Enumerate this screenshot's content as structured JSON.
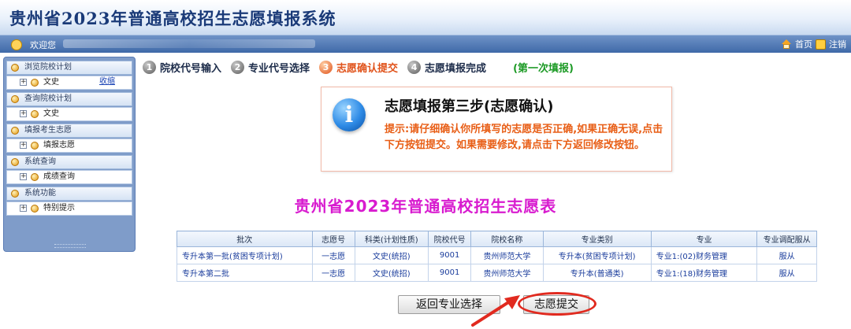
{
  "header": {
    "title": "贵州省2023年普通高校招生志愿填报系统"
  },
  "navbar": {
    "welcome": "欢迎您",
    "home": "首页",
    "logout": "注销"
  },
  "sidebar": {
    "collapse": "收缩",
    "groups": [
      {
        "label": "浏览院校计划",
        "item": "文史"
      },
      {
        "label": "查询院校计划",
        "item": "文史"
      },
      {
        "label": "填报考生志愿",
        "item": "填报志愿"
      },
      {
        "label": "系统查询",
        "item": "成绩查询"
      },
      {
        "label": "系统功能",
        "item": "特别提示"
      }
    ]
  },
  "steps": [
    {
      "num": "1",
      "label": "院校代号输入"
    },
    {
      "num": "2",
      "label": "专业代号选择"
    },
    {
      "num": "3",
      "label": "志愿确认提交"
    },
    {
      "num": "4",
      "label": "志愿填报完成"
    }
  ],
  "fill_round": "(第一次填报)",
  "info": {
    "title": "志愿填报第三步(志愿确认)",
    "text": "提示:请仔细确认你所填写的志愿是否正确,如果正确无误,点击下方按钮提交。如果需要修改,请点击下方返回修改按钮。"
  },
  "table_heading": "贵州省2023年普通高校招生志愿表",
  "table": {
    "headers": [
      "批次",
      "志愿号",
      "科类(计划性质)",
      "院校代号",
      "院校名称",
      "专业类别",
      "专业",
      "专业调配服从"
    ],
    "rows": [
      [
        "专升本第一批(贫困专项计划)",
        "一志愿",
        "文史(统招)",
        "9001",
        "贵州师范大学",
        "专升本(贫困专项计划)",
        "专业1:(02)财务管理",
        "服从"
      ],
      [
        "专升本第二批",
        "一志愿",
        "文史(统招)",
        "9001",
        "贵州师范大学",
        "专升本(普通类)",
        "专业1:(18)财务管理",
        "服从"
      ]
    ]
  },
  "buttons": {
    "back": "返回专业选择",
    "submit": "志愿提交"
  },
  "colors": {
    "accent_orange": "#e0521a",
    "heading_magenta": "#d81bcf",
    "round_green": "#1c9a25",
    "annotation_red": "#e12a1f"
  }
}
